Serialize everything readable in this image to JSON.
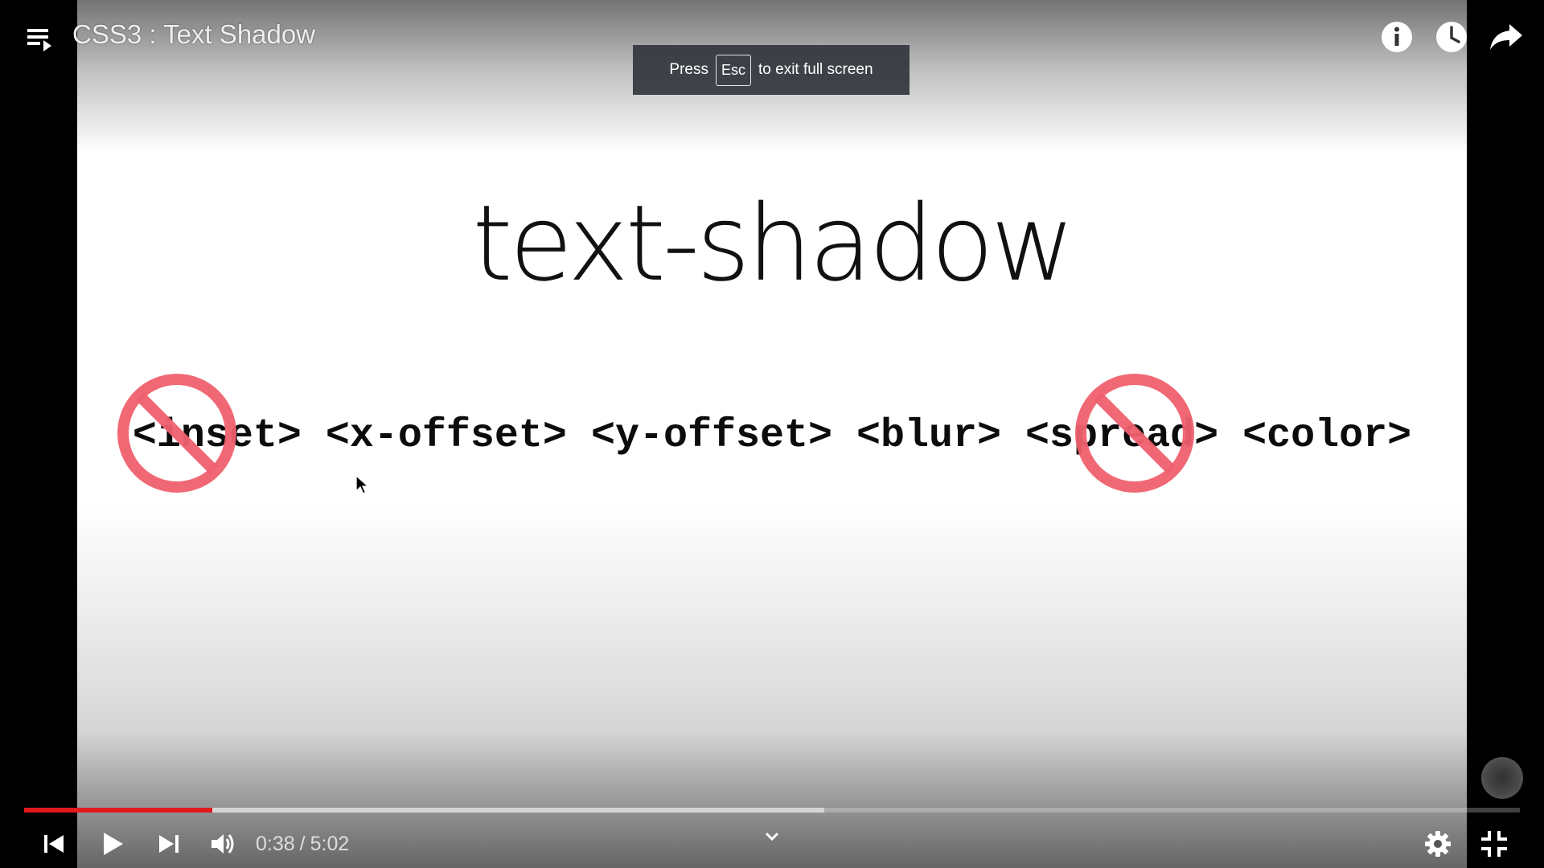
{
  "video": {
    "title": "CSS3 : Text Shadow",
    "slide": {
      "heading": "text-shadow",
      "syntax_tokens": [
        {
          "text": "<inset>",
          "crossed_out": true
        },
        {
          "text": "<x-offset>",
          "crossed_out": false
        },
        {
          "text": "<y-offset>",
          "crossed_out": false
        },
        {
          "text": "<blur>",
          "crossed_out": false
        },
        {
          "text": "<spread>",
          "crossed_out": true
        },
        {
          "text": "<color>",
          "crossed_out": false
        }
      ]
    }
  },
  "top_bar": {
    "icons": [
      "playlist-icon",
      "info-icon",
      "watch-later-icon",
      "share-icon"
    ]
  },
  "toast": {
    "prefix": "Press",
    "key": "Esc",
    "suffix": "to exit full screen"
  },
  "controls": {
    "current_time": "0:38",
    "separator": "/",
    "duration": "5:02",
    "progress_played_fraction": 0.126,
    "progress_loaded_fraction": 0.535,
    "icons": [
      "previous-icon",
      "play-icon",
      "next-icon",
      "volume-icon",
      "chevron-down-icon",
      "settings-icon",
      "exit-fullscreen-icon"
    ]
  },
  "colors": {
    "progress_played": "#e0191c",
    "no_sign": "#f0606e",
    "toast_bg": "#34383e"
  }
}
